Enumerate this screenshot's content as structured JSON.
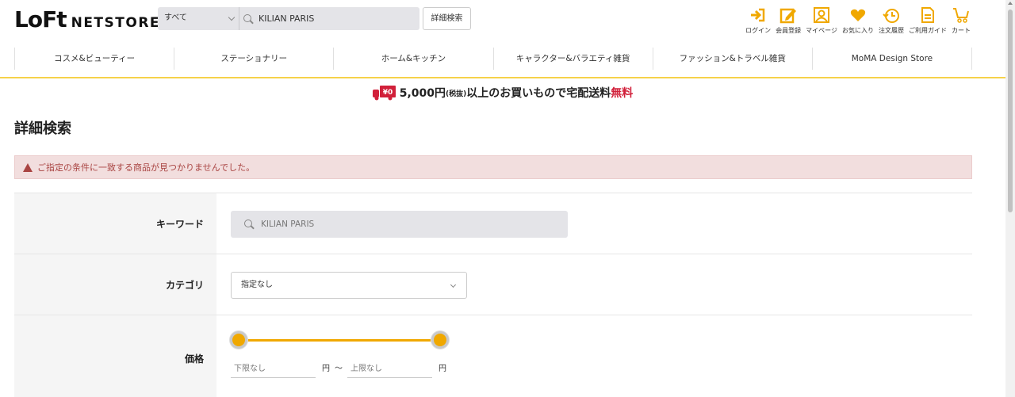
{
  "header": {
    "logo_mark": "LoFt",
    "logo_text": "NETSTORE",
    "search": {
      "category": "すべて",
      "value": "KILIAN PARIS"
    },
    "advanced_button": "詳細検索",
    "util_links": [
      {
        "label": "ログイン",
        "icon": "login-icon"
      },
      {
        "label": "会員登録",
        "icon": "register-icon"
      },
      {
        "label": "マイページ",
        "icon": "mypage-icon"
      },
      {
        "label": "お気に入り",
        "icon": "heart-icon"
      },
      {
        "label": "注文履歴",
        "icon": "history-icon"
      },
      {
        "label": "ご利用ガイド",
        "icon": "guide-icon"
      },
      {
        "label": "カート",
        "icon": "cart-icon"
      }
    ],
    "accent_color": "#f0a800"
  },
  "nav": {
    "items": [
      "コスメ&ビューティー",
      "ステーショナリー",
      "ホーム&キッチン",
      "キャラクター&バラエティ雑貨",
      "ファッション&トラベル雑貨",
      "MoMA Design Store"
    ]
  },
  "promo": {
    "badge": "¥0",
    "amount": "5,000円",
    "tax": "(税抜)",
    "text": "以上のお買いもので宅配送料",
    "free": "無料"
  },
  "page_title": "詳細検索",
  "alert": "ご指定の条件に一致する商品が見つかりませんでした。",
  "form": {
    "keyword": {
      "label": "キーワード",
      "value": "KILIAN PARIS"
    },
    "category": {
      "label": "カテゴリ",
      "value": "指定なし"
    },
    "price": {
      "label": "価格",
      "min_placeholder": "下限なし",
      "max_placeholder": "上限なし",
      "unit": "円",
      "separator": "〜"
    }
  }
}
